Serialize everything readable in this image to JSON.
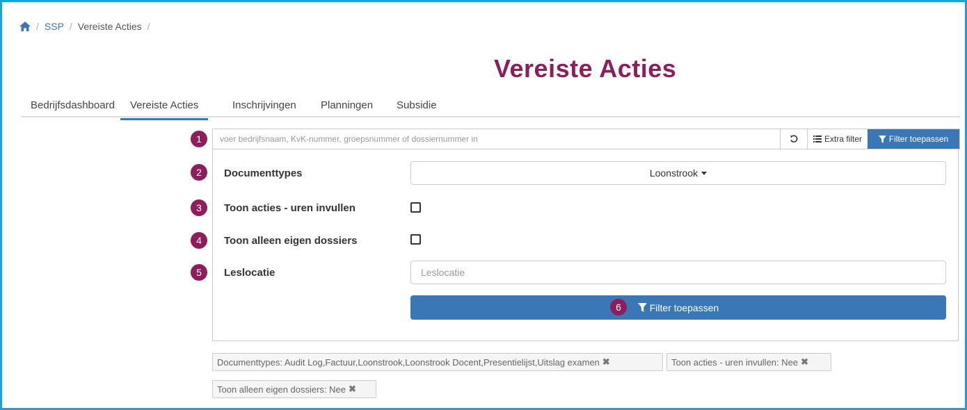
{
  "breadcrumb": {
    "home_icon": "home-icon",
    "sep": "/",
    "item1": "SSP",
    "item2": "Vereiste Acties"
  },
  "page": {
    "title": "Vereiste Acties"
  },
  "tabs": [
    {
      "label": "Bedrijfsdashboard"
    },
    {
      "label": "Vereiste Acties",
      "active": true
    },
    {
      "label": "Inschrijvingen"
    },
    {
      "label": "Planningen"
    },
    {
      "label": "Subsidie"
    }
  ],
  "markers": [
    "1",
    "2",
    "3",
    "4",
    "5",
    "6"
  ],
  "search": {
    "placeholder": "voer bedrijfsnaam, KvK-nummer, groepsnummer of dossiernummer in",
    "value": "",
    "extra_filter_label": "Extra filter",
    "apply_label": "Filter toepassen"
  },
  "form": {
    "documenttypes_label": "Documenttypes",
    "documenttypes_value": "Loonstrook",
    "uren_label": "Toon acties - uren invullen",
    "uren_checked": false,
    "eigen_label": "Toon alleen eigen dossiers",
    "eigen_checked": false,
    "leslocatie_label": "Leslocatie",
    "leslocatie_placeholder": "Leslocatie",
    "leslocatie_value": "",
    "apply_label": "Filter toepassen"
  },
  "chips": [
    {
      "text": "Documenttypes: Audit Log,Factuur,Loonstrook,Loonstrook Docent,Presentielijst,Uitslag examen"
    },
    {
      "text": "Toon acties - uren invullen: Nee"
    },
    {
      "text": "Toon alleen eigen dossiers: Nee"
    }
  ],
  "colors": {
    "accent": "#3a77b6",
    "title": "#8e1d5b",
    "frame": "#1a9fe0"
  }
}
